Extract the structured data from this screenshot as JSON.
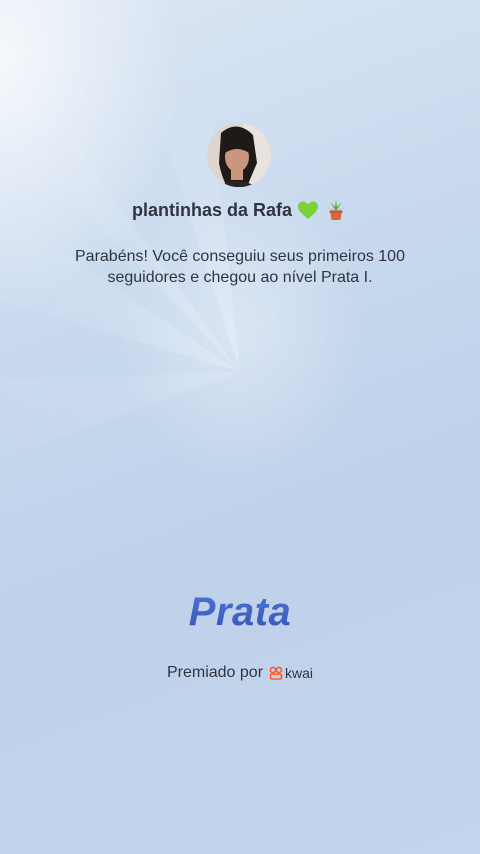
{
  "profile": {
    "name": "plantinhas da Rafa",
    "emojis": [
      "green-heart-icon",
      "potted-plant-icon"
    ]
  },
  "message": {
    "line1": "Parabéns! Você conseguiu seus primeiros 100",
    "line2": "seguidores e chegou ao nível Prata I."
  },
  "level": {
    "name": "Prata"
  },
  "award": {
    "label": "Premiado por",
    "brand": "kwai",
    "brand_color": "#ff5a1f"
  },
  "colors": {
    "level": "#3f63c4",
    "text": "#2f3440"
  }
}
